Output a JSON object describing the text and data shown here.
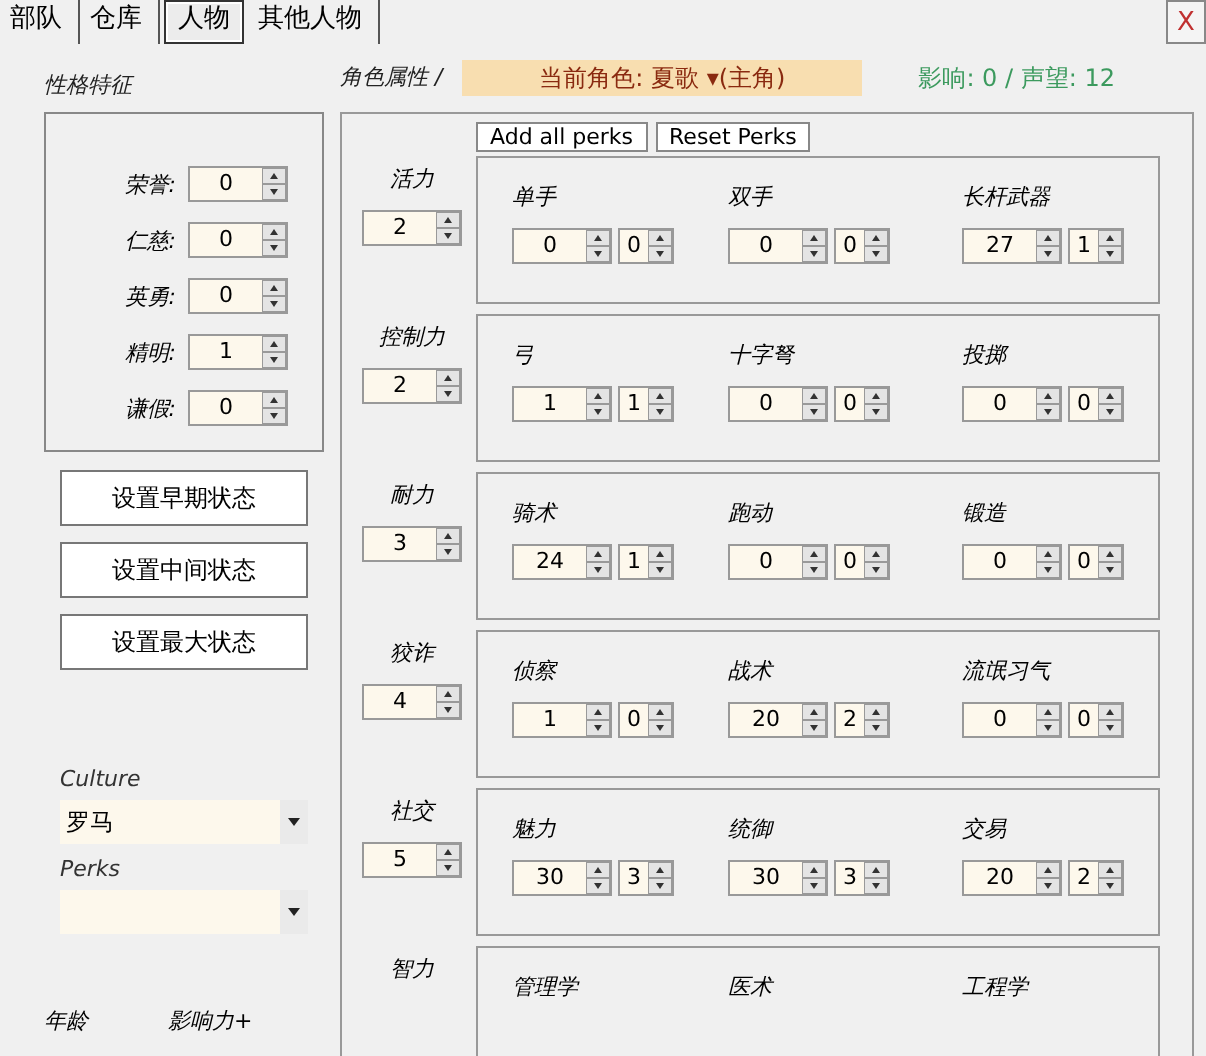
{
  "tabs": [
    {
      "label": "部队",
      "selected": false
    },
    {
      "label": "仓库",
      "selected": false
    },
    {
      "label": "人物",
      "selected": true
    },
    {
      "label": "其他人物",
      "selected": false
    }
  ],
  "close_button": "X",
  "traits_title": "性格特征",
  "traits": [
    {
      "label": "荣誉:",
      "value": "0"
    },
    {
      "label": "仁慈:",
      "value": "0"
    },
    {
      "label": "英勇:",
      "value": "0"
    },
    {
      "label": "精明:",
      "value": "1"
    },
    {
      "label": "谦假:",
      "value": "0"
    }
  ],
  "state_buttons": [
    "设置早期状态",
    "设置中间状态",
    "设置最大状态"
  ],
  "culture": {
    "label": "Culture",
    "value": "罗马"
  },
  "perks": {
    "label": "Perks"
  },
  "bottom_labels": [
    "年龄",
    "影响力+"
  ],
  "attributes_title": "角色属性 /",
  "current_character": "当前角色: 夏歌 ▾(主角)",
  "influence": "影响: 0 / 声望: 12",
  "perk_buttons": [
    "Add all perks",
    "Reset Perks"
  ],
  "attributes": [
    {
      "name": "活力",
      "value": "2",
      "skills": [
        {
          "name": "单手",
          "value": "0",
          "perks": "0"
        },
        {
          "name": "双手",
          "value": "0",
          "perks": "0"
        },
        {
          "name": "长杆武器",
          "value": "27",
          "perks": "1"
        }
      ]
    },
    {
      "name": "控制力",
      "value": "2",
      "skills": [
        {
          "name": "弓",
          "value": "1",
          "perks": "1"
        },
        {
          "name": "十字弩",
          "value": "0",
          "perks": "0"
        },
        {
          "name": "投掷",
          "value": "0",
          "perks": "0"
        }
      ]
    },
    {
      "name": "耐力",
      "value": "3",
      "skills": [
        {
          "name": "骑术",
          "value": "24",
          "perks": "1"
        },
        {
          "name": "跑动",
          "value": "0",
          "perks": "0"
        },
        {
          "name": "锻造",
          "value": "0",
          "perks": "0"
        }
      ]
    },
    {
      "name": "狡诈",
      "value": "4",
      "skills": [
        {
          "name": "侦察",
          "value": "1",
          "perks": "0"
        },
        {
          "name": "战术",
          "value": "20",
          "perks": "2"
        },
        {
          "name": "流氓习气",
          "value": "0",
          "perks": "0"
        }
      ]
    },
    {
      "name": "社交",
      "value": "5",
      "skills": [
        {
          "name": "魅力",
          "value": "30",
          "perks": "3"
        },
        {
          "name": "统御",
          "value": "30",
          "perks": "3"
        },
        {
          "name": "交易",
          "value": "20",
          "perks": "2"
        }
      ]
    },
    {
      "name": "智力",
      "skills": [
        {
          "name": "管理学"
        },
        {
          "name": "医术"
        },
        {
          "name": "工程学"
        }
      ]
    }
  ]
}
